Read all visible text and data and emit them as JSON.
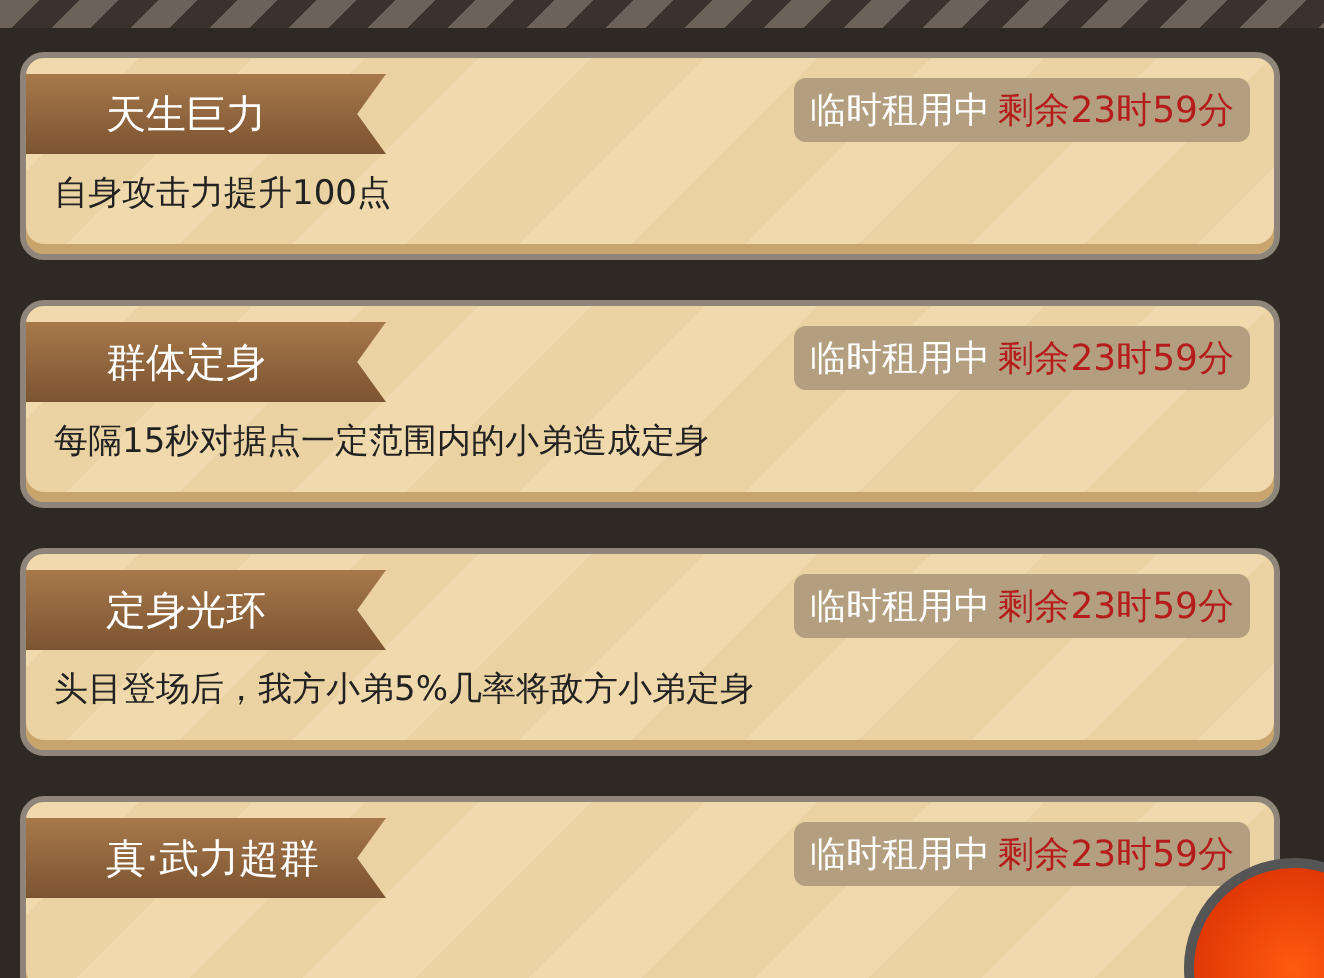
{
  "skills": [
    {
      "title": "天生巨力",
      "status": "临时租用中",
      "remaining": "剩余23时59分",
      "description": "自身攻击力提升100点"
    },
    {
      "title": "群体定身",
      "status": "临时租用中",
      "remaining": "剩余23时59分",
      "description": "每隔15秒对据点一定范围内的小弟造成定身"
    },
    {
      "title": "定身光环",
      "status": "临时租用中",
      "remaining": "剩余23时59分",
      "description": "头目登场后，我方小弟5%几率将敌方小弟定身"
    },
    {
      "title": "真·武力超群",
      "status": "临时租用中",
      "remaining": "剩余23时59分"
    }
  ]
}
